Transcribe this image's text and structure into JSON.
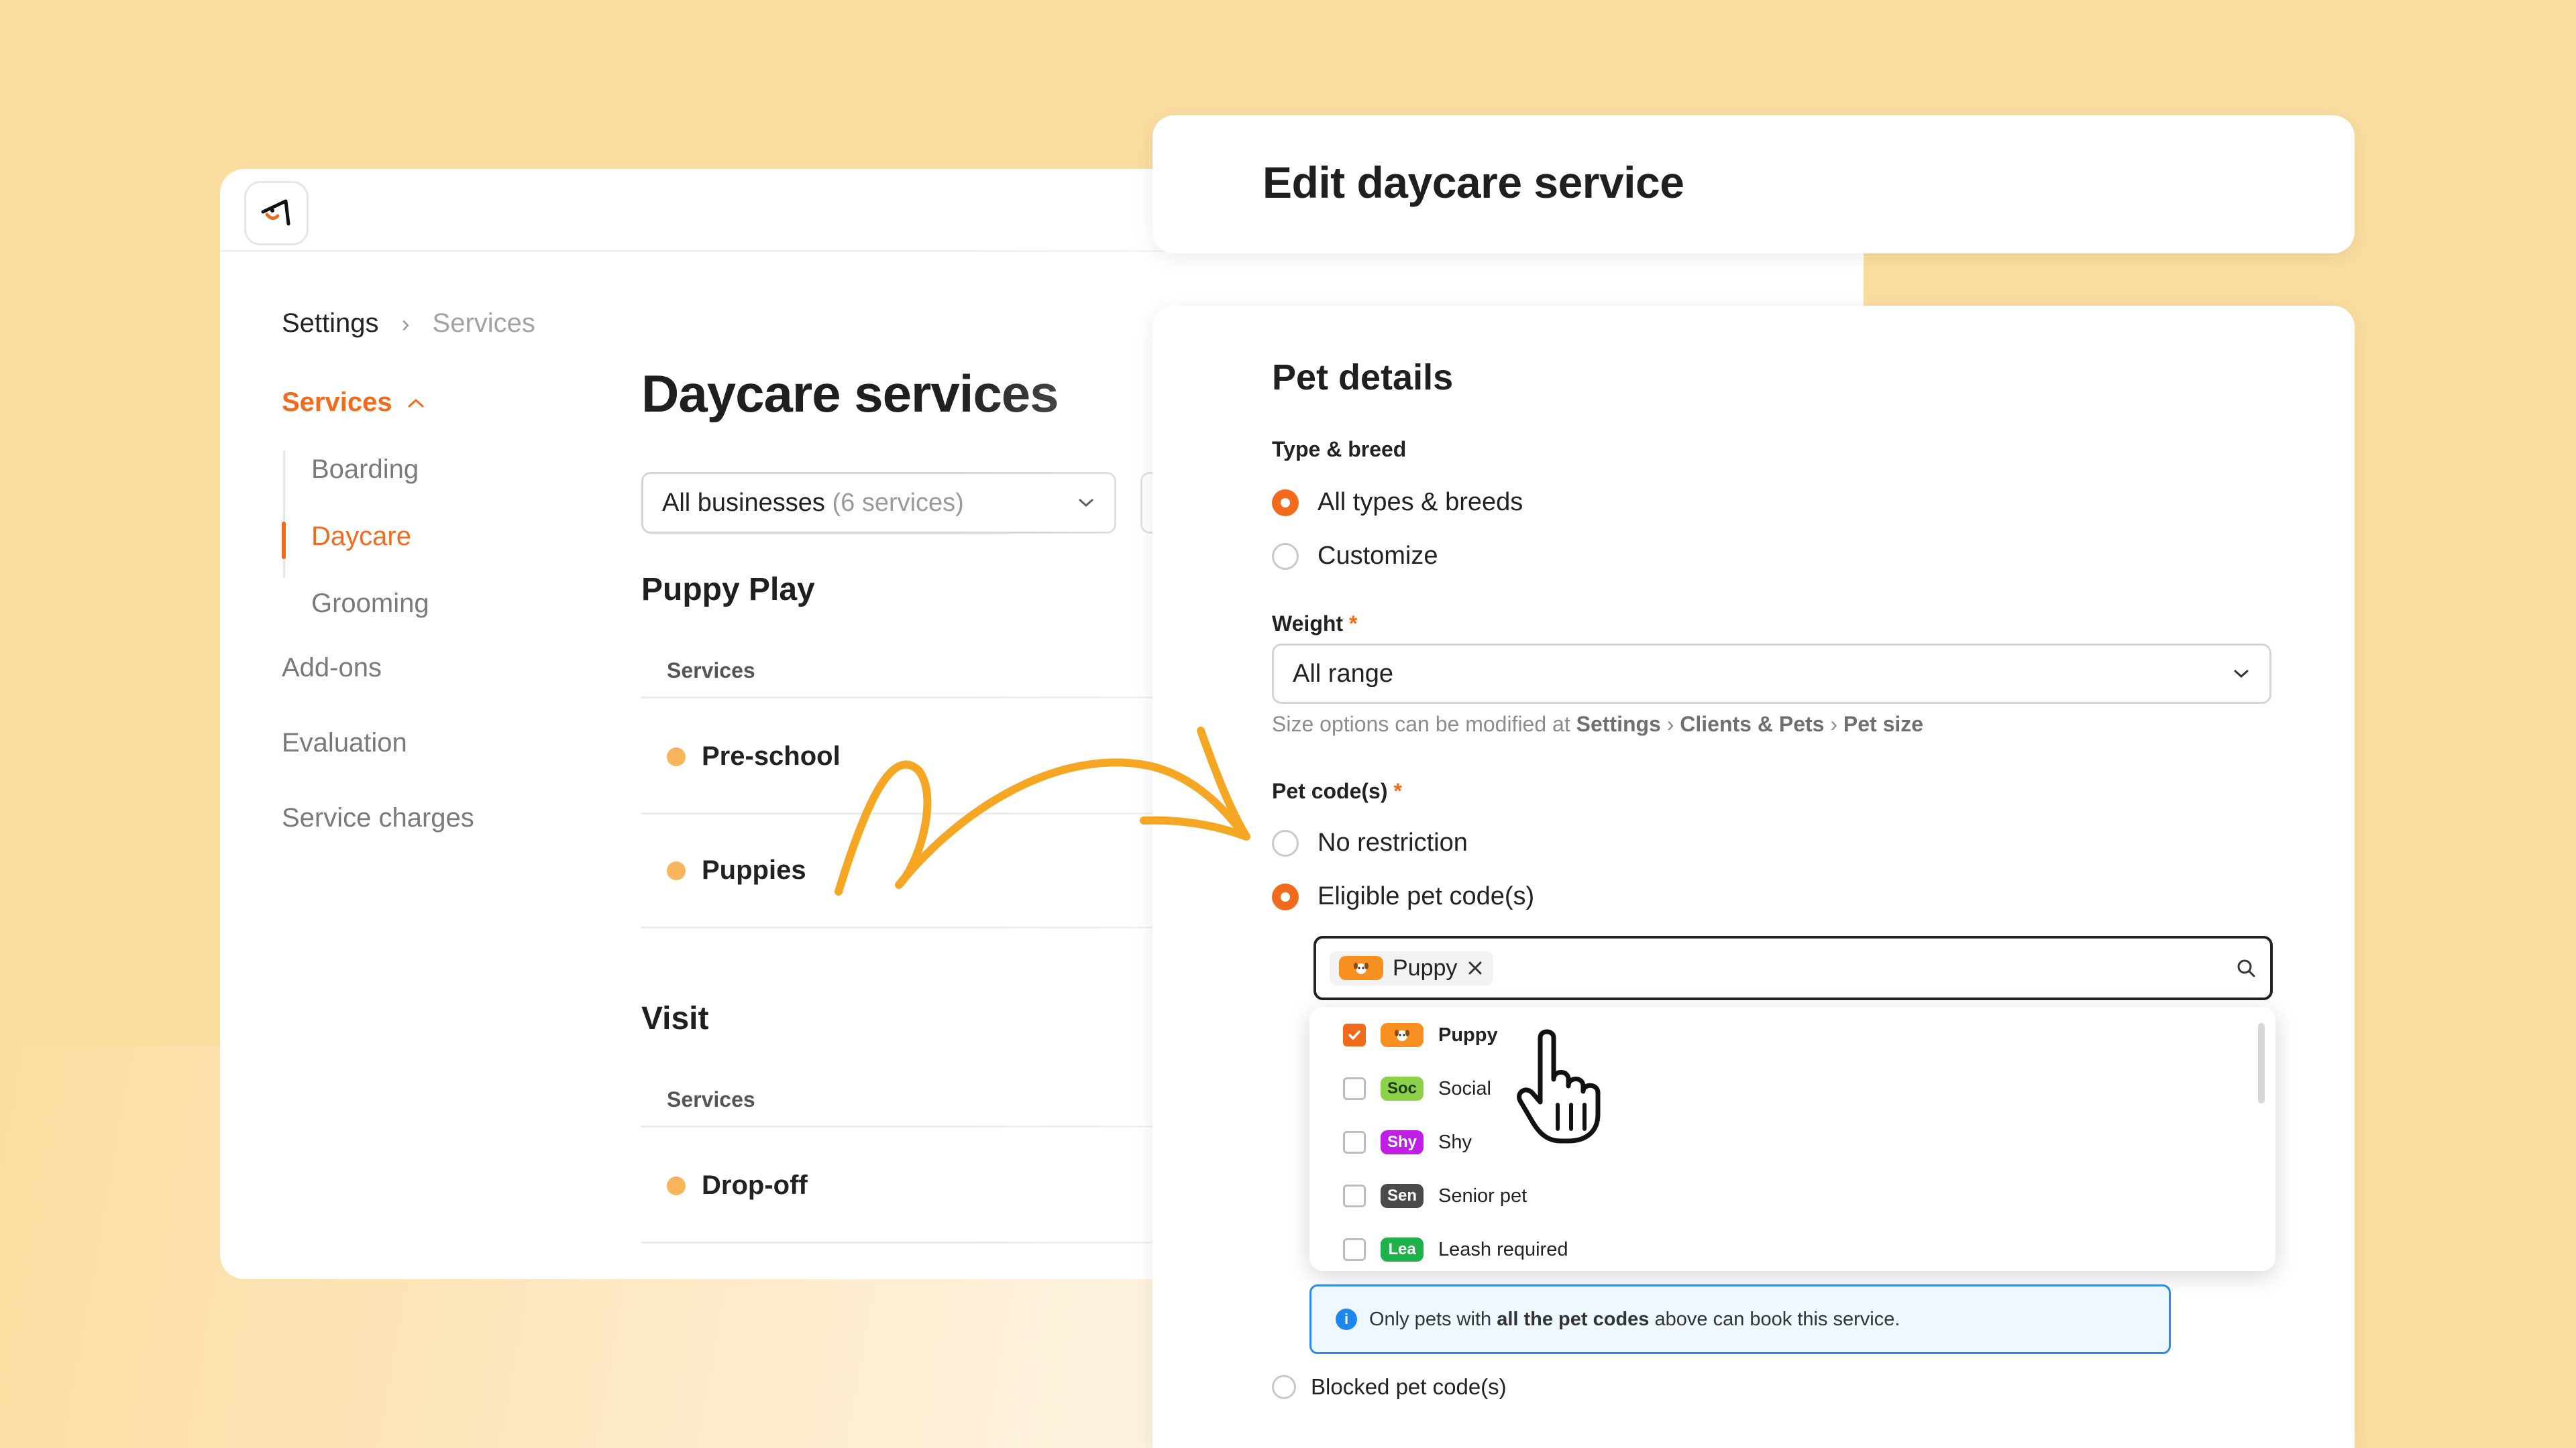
{
  "breadcrumb": {
    "settings": "Settings",
    "services": "Services"
  },
  "sidebar": {
    "services_label": "Services",
    "sub_items": [
      {
        "label": "Boarding",
        "active": false
      },
      {
        "label": "Daycare",
        "active": true
      },
      {
        "label": "Grooming",
        "active": false
      }
    ],
    "items": [
      {
        "label": "Add-ons"
      },
      {
        "label": "Evaluation"
      },
      {
        "label": "Service charges"
      }
    ]
  },
  "main": {
    "title": "Daycare services",
    "business_select": {
      "value": "All businesses",
      "count": "(6 services)"
    },
    "groups": [
      {
        "title": "Puppy Play",
        "column_header": "Services",
        "services": [
          "Pre-school",
          "Puppies"
        ]
      },
      {
        "title": "Visit",
        "column_header": "Services",
        "services": [
          "Drop-off"
        ]
      }
    ]
  },
  "edit": {
    "title": "Edit daycare service",
    "section_title": "Pet details",
    "type_breed": {
      "label": "Type & breed",
      "options": [
        {
          "label": "All types & breeds",
          "selected": true
        },
        {
          "label": "Customize",
          "selected": false
        }
      ]
    },
    "weight": {
      "label": "Weight",
      "required": "*",
      "value": "All range",
      "hint_prefix": "Size options can be modified at",
      "hint_path": [
        "Settings",
        "Clients & Pets",
        "Pet size"
      ],
      "hint_sep": "›"
    },
    "pet_codes": {
      "label": "Pet code(s)",
      "required": "*",
      "options": [
        {
          "label": "No restriction",
          "selected": false
        },
        {
          "label": "Eligible pet code(s)",
          "selected": true
        }
      ],
      "selected_chip": "Puppy",
      "dropdown": [
        {
          "tag": "",
          "label": "Puppy",
          "checked": true,
          "color": "#F7901E"
        },
        {
          "tag": "Soc",
          "label": "Social",
          "checked": false,
          "color": "#8BD24A"
        },
        {
          "tag": "Shy",
          "label": "Shy",
          "checked": false,
          "color": "#C21FE6"
        },
        {
          "tag": "Sen",
          "label": "Senior pet",
          "checked": false,
          "color": "#4A4A4A"
        },
        {
          "tag": "Lea",
          "label": "Leash required",
          "checked": false,
          "color": "#1DB24A"
        }
      ],
      "info": {
        "prefix": "Only pets with",
        "bold": "all the pet codes",
        "suffix": "above can book this service."
      },
      "blocked_label": "Blocked pet code(s)"
    }
  },
  "colors": {
    "accent": "#F26B1D",
    "background": "#FCDDA0",
    "arrow": "#F5A623",
    "info_border": "#2A8BF2"
  }
}
